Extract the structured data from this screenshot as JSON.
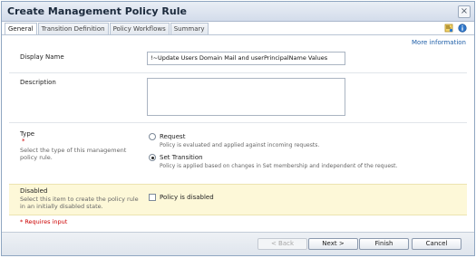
{
  "window": {
    "title": "Create Management Policy Rule",
    "close_glyph": "×"
  },
  "tabs": [
    {
      "label": "General"
    },
    {
      "label": "Transition Definition"
    },
    {
      "label": "Policy Workflows"
    },
    {
      "label": "Summary"
    }
  ],
  "header": {
    "more_info": "More information"
  },
  "form": {
    "display_name": {
      "label": "Display Name",
      "value": "!~Update Users Domain Mail and userPrincipalName Values"
    },
    "description": {
      "label": "Description",
      "value": ""
    },
    "type": {
      "label": "Type",
      "required_marker": "*",
      "help": "Select the type of this management policy rule.",
      "options": [
        {
          "label": "Request",
          "description": "Policy is evaluated and applied against incoming requests.",
          "selected": false
        },
        {
          "label": "Set Transition",
          "description": "Policy is applied based on changes in Set membership and independent of the request.",
          "selected": true
        }
      ]
    },
    "disabled": {
      "label": "Disabled",
      "help": "Select this item to create the policy rule in an initially disabled state.",
      "checkbox_label": "Policy is disabled",
      "checked": false
    },
    "requires_input_note": "* Requires input"
  },
  "footer": {
    "back_label": "< Back",
    "next_label": "Next >",
    "finish_label": "Finish",
    "cancel_label": "Cancel"
  },
  "icons": [
    "help-book-icon",
    "info-icon"
  ]
}
